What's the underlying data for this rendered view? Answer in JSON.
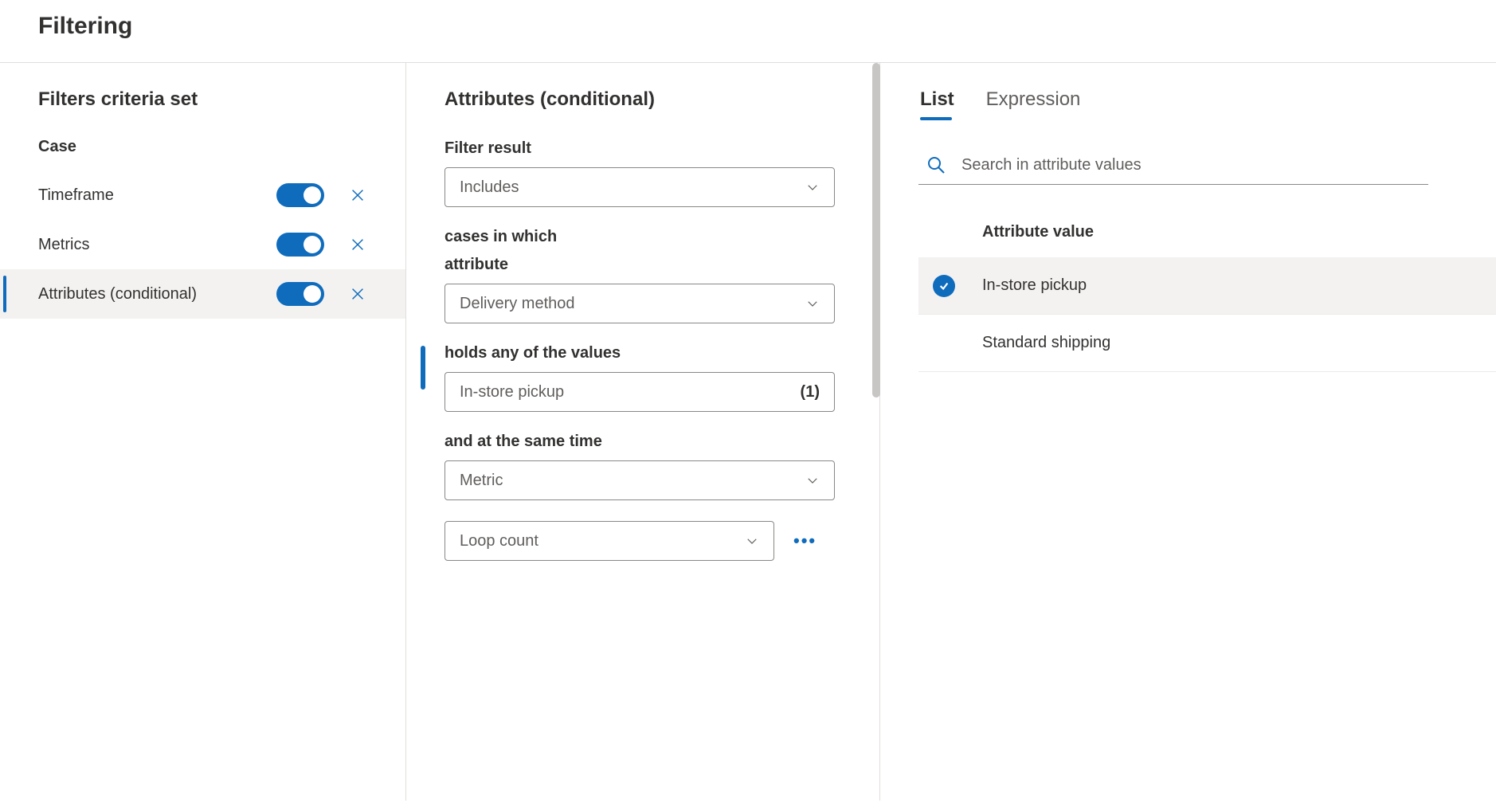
{
  "page": {
    "title": "Filtering"
  },
  "left": {
    "title": "Filters criteria set",
    "group": "Case",
    "items": [
      {
        "label": "Timeframe",
        "enabled": true,
        "selected": false
      },
      {
        "label": "Metrics",
        "enabled": true,
        "selected": false
      },
      {
        "label": "Attributes (conditional)",
        "enabled": true,
        "selected": true
      }
    ]
  },
  "middle": {
    "title": "Attributes (conditional)",
    "labels": {
      "filter_result": "Filter result",
      "cases_in_which": "cases in which",
      "attribute": "attribute",
      "holds_values": "holds any of the values",
      "and_same_time": "and at the same time"
    },
    "selects": {
      "filter_result": "Includes",
      "attribute": "Delivery method",
      "holds_value_text": "In-store pickup",
      "holds_value_count": "(1)",
      "metric_type": "Metric",
      "metric_name": "Loop count"
    }
  },
  "right": {
    "tabs": {
      "list": "List",
      "expression": "Expression"
    },
    "search_placeholder": "Search in attribute values",
    "header": "Attribute value",
    "values": [
      {
        "label": "In-store pickup",
        "checked": true
      },
      {
        "label": "Standard shipping",
        "checked": false
      }
    ]
  }
}
